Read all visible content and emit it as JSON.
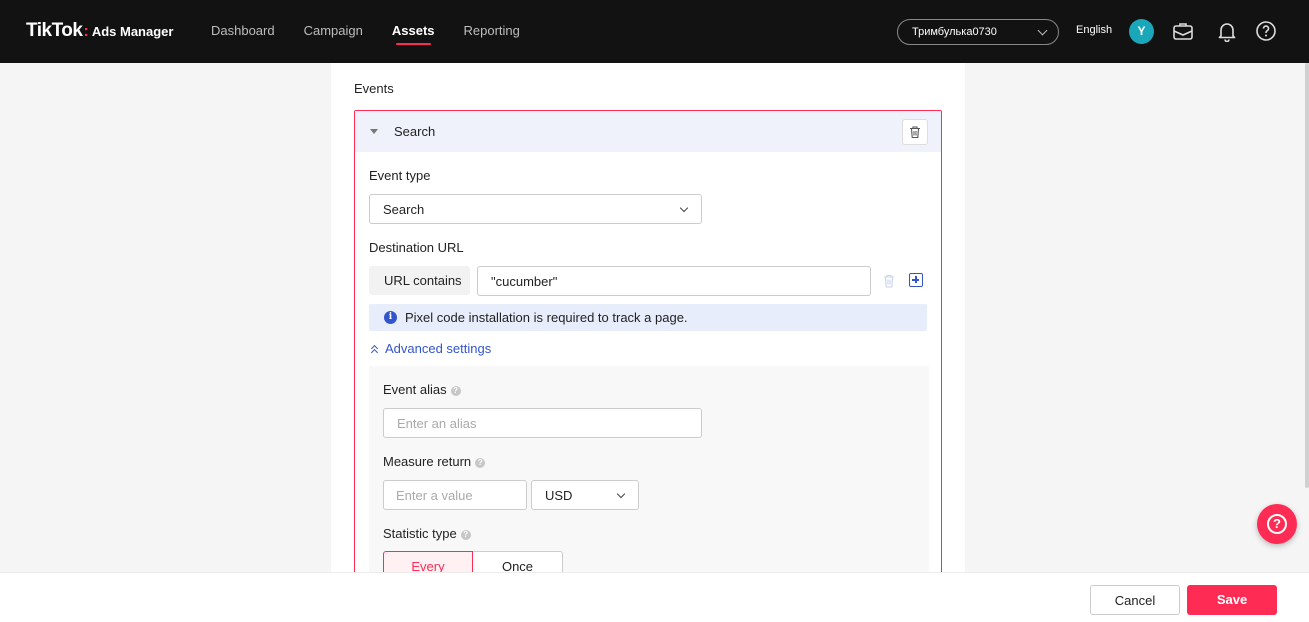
{
  "header": {
    "logo_text": "TikTok",
    "logo_sub": "Ads Manager",
    "nav": [
      {
        "label": "Dashboard"
      },
      {
        "label": "Campaign"
      },
      {
        "label": "Assets"
      },
      {
        "label": "Reporting"
      }
    ],
    "active_nav": "Assets",
    "account": "Тримбулька0730",
    "language": "English",
    "avatar_initial": "Y",
    "icons": [
      "briefcase-icon",
      "bell-icon",
      "help-icon"
    ]
  },
  "main": {
    "section_title": "Events",
    "event": {
      "title": "Search",
      "event_type_label": "Event type",
      "event_type_value": "Search",
      "destination_label": "Destination URL",
      "url_condition": "URL contains",
      "url_value": "\"cucumber\"",
      "notice": "Pixel code installation is required to track a page.",
      "advanced_label": "Advanced settings",
      "advanced": {
        "alias_label": "Event alias",
        "alias_placeholder": "Enter an alias",
        "measure_label": "Measure return",
        "measure_placeholder": "Enter a value",
        "currency": "USD",
        "statistic_label": "Statistic type",
        "statistic_options": [
          "Every",
          "Once"
        ],
        "statistic_selected": "Every"
      }
    }
  },
  "footer": {
    "cancel_label": "Cancel",
    "save_label": "Save"
  },
  "colors": {
    "brand": "#fe2c55",
    "link": "#3355cc",
    "topbar": "#121212"
  }
}
